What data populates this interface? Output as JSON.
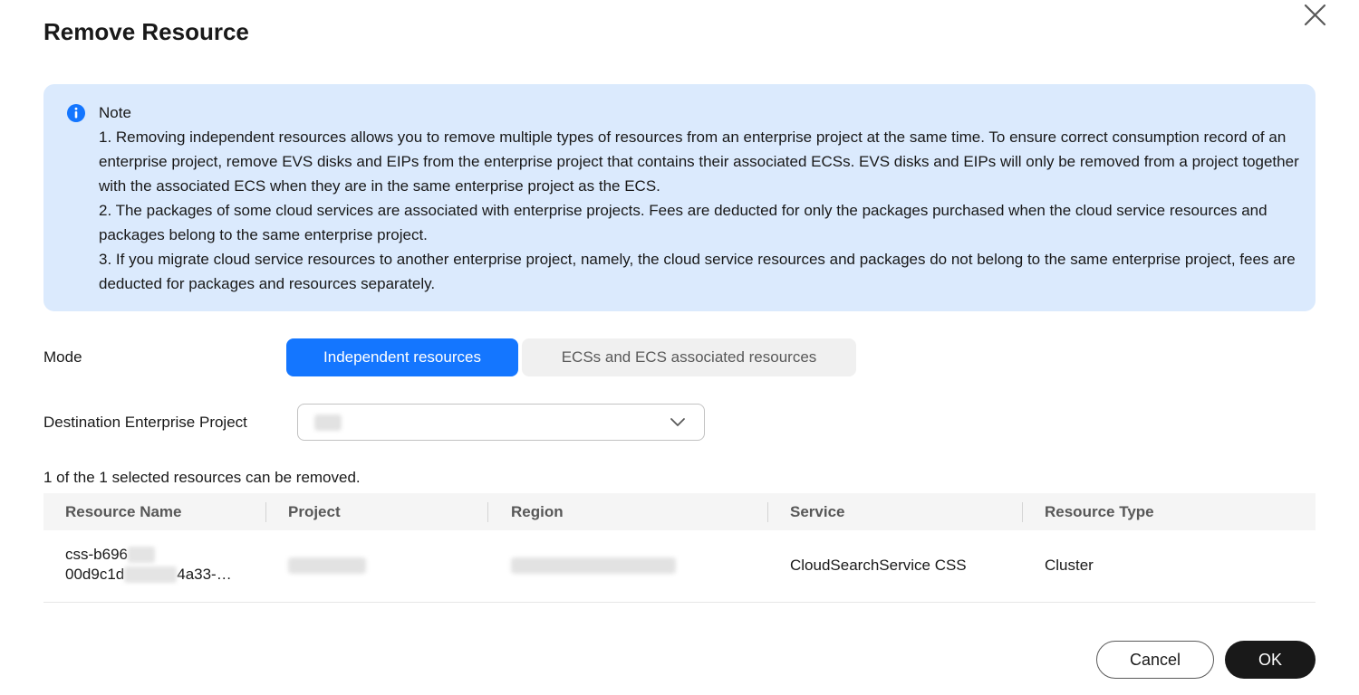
{
  "dialog": {
    "title": "Remove Resource",
    "close_icon": "close-icon"
  },
  "note": {
    "icon": "info-icon",
    "title": "Note",
    "items": [
      "1. Removing independent resources allows you to remove multiple types of resources from an enterprise project at the same time. To ensure correct consumption record of an enterprise project, remove EVS disks and EIPs from the enterprise project that contains their associated ECSs. EVS disks and EIPs will only be removed from a project together with the associated ECS when they are in the same enterprise project as the ECS.",
      "2. The packages of some cloud services are associated with enterprise projects. Fees are deducted for only the packages purchased when the cloud service resources and packages belong to the same enterprise project.",
      "3. If you migrate cloud service resources to another enterprise project, namely, the cloud service resources and packages do not belong to the same enterprise project, fees are deducted for packages and resources separately."
    ],
    "background": "#dbeafd",
    "icon_color": "#1476ff"
  },
  "mode": {
    "label": "Mode",
    "options": [
      "Independent resources",
      "ECSs and ECS associated resources"
    ],
    "selected": "Independent resources",
    "accent": "#1476ff"
  },
  "destination": {
    "label": "Destination Enterprise Project",
    "chevron_icon": "chevron-down-icon"
  },
  "summary": "1 of the 1 selected resources can be removed.",
  "table": {
    "columns": [
      "Resource Name",
      "Project",
      "Region",
      "Service",
      "Resource Type"
    ],
    "rows": [
      {
        "name_line1": "css-b696",
        "name_line2_a": "00d9c1d",
        "name_line2_b": "4a33-…",
        "service": "CloudSearchService CSS",
        "type": "Cluster"
      }
    ]
  },
  "footer": {
    "cancel": "Cancel",
    "ok": "OK"
  }
}
